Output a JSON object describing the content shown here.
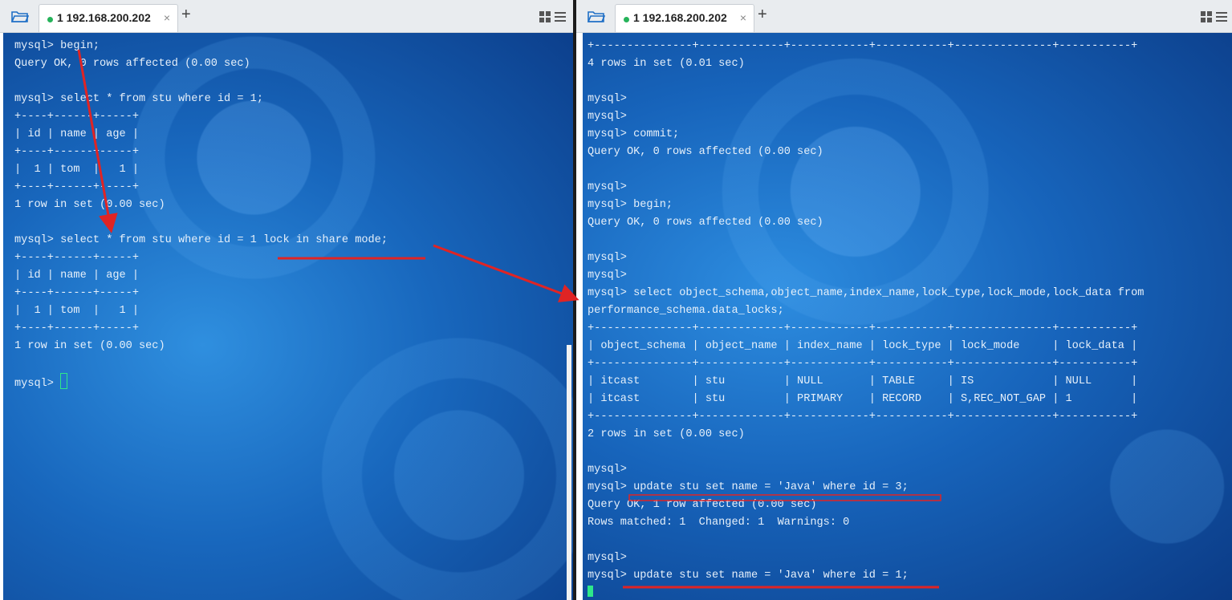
{
  "left_pane": {
    "tab_title": "1 192.168.200.202",
    "tab_close": "×",
    "tab_add": "+",
    "lines": [
      "mysql> begin;",
      "Query OK, 0 rows affected (0.00 sec)",
      "",
      "mysql> select * from stu where id = 1;",
      "+----+------+-----+",
      "| id | name | age |",
      "+----+------+-----+",
      "|  1 | tom  |   1 |",
      "+----+------+-----+",
      "1 row in set (0.00 sec)",
      "",
      "mysql> select * from stu where id = 1 lock in share mode;",
      "+----+------+-----+",
      "| id | name | age |",
      "+----+------+-----+",
      "|  1 | tom  |   1 |",
      "+----+------+-----+",
      "1 row in set (0.00 sec)",
      "",
      "mysql> "
    ]
  },
  "right_pane": {
    "tab_title": "1 192.168.200.202",
    "tab_close": "×",
    "tab_add": "+",
    "lines": [
      "+---------------+-------------+------------+-----------+---------------+-----------+",
      "4 rows in set (0.01 sec)",
      "",
      "mysql>",
      "mysql>",
      "mysql> commit;",
      "Query OK, 0 rows affected (0.00 sec)",
      "",
      "mysql>",
      "mysql> begin;",
      "Query OK, 0 rows affected (0.00 sec)",
      "",
      "mysql>",
      "mysql>",
      "mysql> select object_schema,object_name,index_name,lock_type,lock_mode,lock_data from",
      "performance_schema.data_locks;",
      "+---------------+-------------+------------+-----------+---------------+-----------+",
      "| object_schema | object_name | index_name | lock_type | lock_mode     | lock_data |",
      "+---------------+-------------+------------+-----------+---------------+-----------+",
      "| itcast        | stu         | NULL       | TABLE     | IS            | NULL      |",
      "| itcast        | stu         | PRIMARY    | RECORD    | S,REC_NOT_GAP | 1         |",
      "+---------------+-------------+------------+-----------+---------------+-----------+",
      "2 rows in set (0.00 sec)",
      "",
      "mysql>",
      "mysql> update stu set name = 'Java' where id = 3;",
      "Query OK, 1 row affected (0.00 sec)",
      "Rows matched: 1  Changed: 1  Warnings: 0",
      "",
      "mysql>",
      "mysql> update stu set name = 'Java' where id = 1;"
    ]
  },
  "colors": {
    "terminal_text": "#e6f0fa",
    "annotation_red": "#e02424",
    "cursor_green": "#2ee88a",
    "tab_dot_green": "#26b35a"
  },
  "icons": [
    "folder-open-icon",
    "layout-grid-icon",
    "menu-icon",
    "plus-icon",
    "close-icon"
  ]
}
